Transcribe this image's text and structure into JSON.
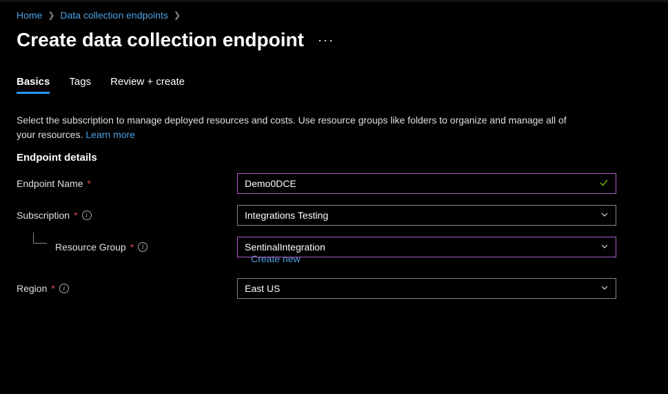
{
  "breadcrumb": {
    "home": "Home",
    "dce": "Data collection endpoints"
  },
  "page_title": "Create data collection endpoint",
  "tabs": {
    "basics": "Basics",
    "tags": "Tags",
    "review": "Review + create"
  },
  "description": "Select the subscription to manage deployed resources and costs. Use resource groups like folders to organize and manage all of your resources.",
  "learn_more": "Learn more",
  "section_header": "Endpoint details",
  "form": {
    "endpoint_name": {
      "label": "Endpoint Name",
      "value": "Demo0DCE"
    },
    "subscription": {
      "label": "Subscription",
      "value": "Integrations Testing"
    },
    "resource_group": {
      "label": "Resource Group",
      "value": "SentinalIntegration",
      "create_new": "Create new"
    },
    "region": {
      "label": "Region",
      "value": "East US"
    }
  }
}
